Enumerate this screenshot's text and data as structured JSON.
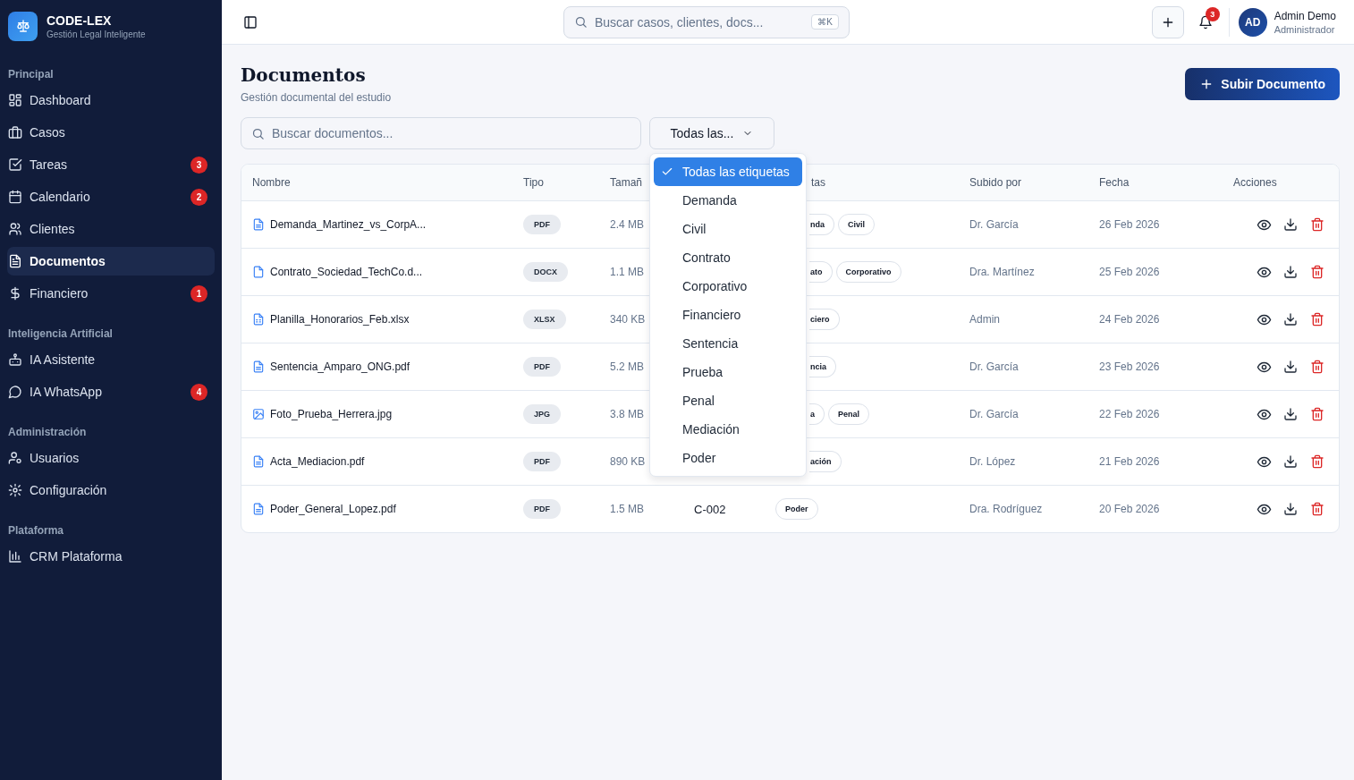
{
  "sidebar": {
    "brand": {
      "name": "CODE-LEX",
      "tagline": "Gestión Legal Inteligente"
    },
    "sections": [
      {
        "title": "Principal",
        "items": [
          {
            "label": "Dashboard",
            "selected": false
          },
          {
            "label": "Casos",
            "selected": false
          },
          {
            "label": "Tareas",
            "badge": "3",
            "selected": false
          },
          {
            "label": "Calendario",
            "badge": "2",
            "selected": false
          },
          {
            "label": "Clientes",
            "selected": false
          },
          {
            "label": "Documentos",
            "selected": true
          },
          {
            "label": "Financiero",
            "badge": "1",
            "selected": false
          }
        ]
      },
      {
        "title": "Inteligencia Artificial",
        "items": [
          {
            "label": "IA Asistente",
            "selected": false
          },
          {
            "label": "IA WhatsApp",
            "badge": "4",
            "selected": false
          }
        ]
      },
      {
        "title": "Administración",
        "items": [
          {
            "label": "Usuarios",
            "selected": false
          },
          {
            "label": "Configuración",
            "selected": false
          }
        ]
      },
      {
        "title": "Plataforma",
        "items": [
          {
            "label": "CRM Plataforma",
            "selected": false
          }
        ]
      }
    ]
  },
  "topbar": {
    "search": {
      "placeholder": "Buscar casos, clientes, docs...",
      "shortcut": "⌘K"
    },
    "notifications": "3",
    "user": {
      "initials": "AD",
      "name": "Admin Demo",
      "role": "Administrador"
    }
  },
  "page": {
    "title": "Documentos",
    "subtitle": "Gestión documental del estudio",
    "upload_button": "Subir Documento"
  },
  "filters": {
    "search": {
      "placeholder": "Buscar documentos..."
    },
    "tag_select": {
      "value": "Todas las...",
      "options": [
        {
          "label": "Todas las etiquetas",
          "selected": true
        },
        {
          "label": "Demanda",
          "selected": false
        },
        {
          "label": "Civil",
          "selected": false
        },
        {
          "label": "Contrato",
          "selected": false
        },
        {
          "label": "Corporativo",
          "selected": false
        },
        {
          "label": "Financiero",
          "selected": false
        },
        {
          "label": "Sentencia",
          "selected": false
        },
        {
          "label": "Prueba",
          "selected": false
        },
        {
          "label": "Penal",
          "selected": false
        },
        {
          "label": "Mediación",
          "selected": false
        },
        {
          "label": "Poder",
          "selected": false
        }
      ]
    }
  },
  "table": {
    "columns": [
      "Nombre",
      "Tipo",
      "Tamañ",
      "tas",
      "Subido por",
      "Fecha",
      "Acciones"
    ],
    "rows": [
      {
        "name": "Demanda_Martinez_vs_CorpA...",
        "type": "PDF",
        "size": "2.4 MB",
        "tags": [
          "nda",
          "Civil"
        ],
        "uploaded_by": "Dr. García",
        "date": "26 Feb 2026"
      },
      {
        "name": "Contrato_Sociedad_TechCo.d...",
        "type": "DOCX",
        "size": "1.1 MB",
        "tags": [
          "ato",
          "Corporativo"
        ],
        "uploaded_by": "Dra. Martínez",
        "date": "25 Feb 2026"
      },
      {
        "name": "Planilla_Honorarios_Feb.xlsx",
        "type": "XLSX",
        "size": "340 KB",
        "tags": [
          "ciero"
        ],
        "uploaded_by": "Admin",
        "date": "24 Feb 2026"
      },
      {
        "name": "Sentencia_Amparo_ONG.pdf",
        "type": "PDF",
        "size": "5.2 MB",
        "tags": [
          "ncia"
        ],
        "uploaded_by": "Dr. García",
        "date": "23 Feb 2026"
      },
      {
        "name": "Foto_Prueba_Herrera.jpg",
        "type": "JPG",
        "size": "3.8 MB",
        "tags": [
          "a",
          "Penal"
        ],
        "uploaded_by": "Dr. García",
        "date": "22 Feb 2026"
      },
      {
        "name": "Acta_Mediacion.pdf",
        "type": "PDF",
        "size": "890 KB",
        "tags": [
          "ación"
        ],
        "uploaded_by": "Dr. López",
        "date": "21 Feb 2026"
      },
      {
        "name": "Poder_General_Lopez.pdf",
        "type": "PDF",
        "size": "1.5 MB",
        "case": "C-002",
        "tags": [
          "Poder"
        ],
        "uploaded_by": "Dra. Rodríguez",
        "date": "20 Feb 2026"
      }
    ]
  }
}
